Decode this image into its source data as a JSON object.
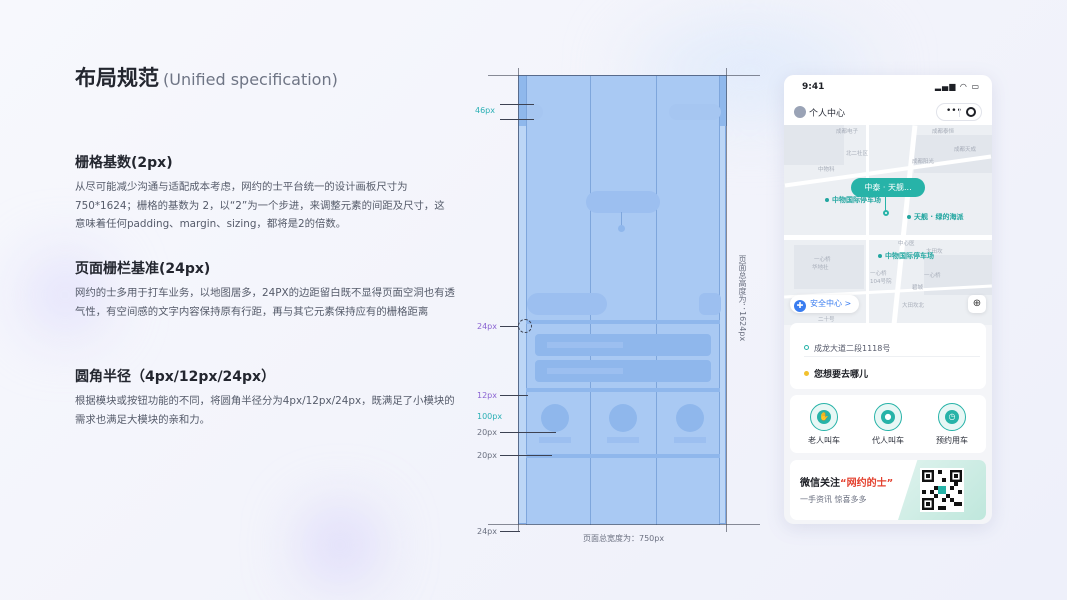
{
  "title": {
    "main": "布局规范",
    "sub": "(Unified specification)"
  },
  "sections": [
    {
      "heading": "栅格基数(2px)",
      "body": "从尽可能减少沟通与适配成本考虑，网约的士平台统一的设计画板尺寸为750*1624；栅格的基数为 2，以“2”为一个步进，来调整元素的间距及尺寸，这意味着任何padding、margin、sizing，都将是2的倍数。"
    },
    {
      "heading": "页面栅栏基准(24px)",
      "body": "网约的士多用于打车业务，以地图居多，24PX的边距留白既不显得页面空洞也有透气性，有空间感的文字内容保持原有行距，再与其它元素保持应有的栅格距离"
    },
    {
      "heading": "圆角半径（4px/12px/24px）",
      "body": "根据模块或按钮功能的不同，将圆角半径分为4px/12px/24px，既满足了小模块的需求也满足大模块的亲和力。"
    }
  ],
  "annotations": {
    "a46": "46px",
    "a24_mid": "24px",
    "a12": "12px",
    "a100": "100px",
    "a20_1": "20px",
    "a20_2": "20px",
    "a24_bottom": "24px",
    "width_total": "页面总宽度为：750px",
    "height_total": "页面总高度为：1624px"
  },
  "colors": {
    "teal": "#27b3a8",
    "wireframe": "#a9c9f3",
    "accent_blue": "#3a7df0",
    "quote_red": "#e3412f"
  },
  "phone": {
    "status": {
      "time": "9:41",
      "icons": "signal-wifi-battery"
    },
    "header": {
      "label": "个人中心",
      "capsule_more": "•••",
      "capsule_icon": "target-icon"
    },
    "map": {
      "bubble": "中泰 · 天舰...",
      "pois": [
        "中物国际停车场",
        "天舰 · 绿的海派",
        "中物国际停车场"
      ],
      "labels": [
        "成都电子",
        "北二社区",
        "成都泰恒",
        "成都阳光",
        "成都天成",
        "中物科",
        "一心桥",
        "华地社",
        "一心桥",
        "104号院",
        "大田坎",
        "一心桥",
        "中心医",
        "碧城",
        "二十",
        "大田坎北",
        "二十号"
      ],
      "safety": "安全中心 >"
    },
    "address": {
      "from": "成龙大道二段1118号",
      "to": "您想要去哪儿"
    },
    "services": [
      {
        "label": "老人叫车",
        "icon": "hand-icon"
      },
      {
        "label": "代人叫车",
        "icon": "person-icon"
      },
      {
        "label": "预约用车",
        "icon": "clock-icon"
      }
    ],
    "ad": {
      "prefix": "微信关注",
      "quoted": "“网约的士”",
      "sub": "一手资讯   惊喜多多"
    }
  }
}
